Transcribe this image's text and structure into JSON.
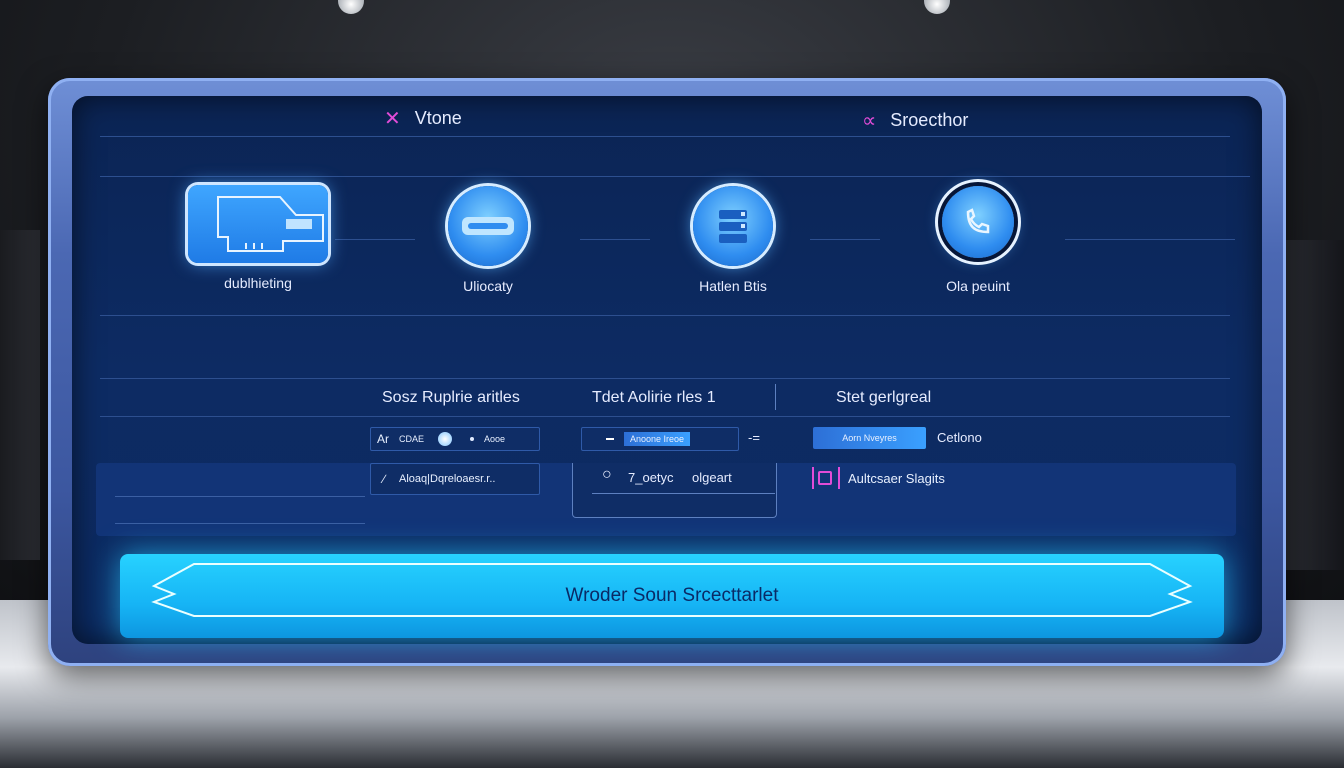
{
  "header": {
    "left": {
      "icon": "pen-icon",
      "label": "Vtone"
    },
    "right": {
      "icon": "link-icon",
      "label": "Sroecthor"
    }
  },
  "tiles": [
    {
      "icon": "screen-icon",
      "label": "dublhieting"
    },
    {
      "icon": "drive-icon",
      "label": "Uliocaty"
    },
    {
      "icon": "storage-icon",
      "label": "Hatlen Btis"
    },
    {
      "icon": "phone-icon",
      "label": "Ola peuint"
    }
  ],
  "sections": {
    "col1_title": "Sosz Ruplrie aritles",
    "col2_title": "Tdet Aolirie rles 1",
    "col3_title": "Stet gerlgreal"
  },
  "controls": {
    "r1_c1_prefix": "Ar",
    "r1_c1_mid": "CDAE",
    "r1_c1_suffix": "Aooe",
    "r1_c2_text": "Anoone Ireoe",
    "r1_c2_suffix": "-=",
    "r1_c3_text": "Aorn Nveyres",
    "r1_c3_label": "Cetlono",
    "r2_c1_text": "Aloaq|Dqreloaesr.r..",
    "r2_c2_label1": "7_oetyc",
    "r2_c2_label2": "olgeart",
    "r2_c3_text": "Aultcsaer Slagits"
  },
  "cta": {
    "label": "Wroder Soun Srcecttarlet"
  },
  "colors": {
    "accent": "#22c4ff",
    "screen_bg": "#0c2a61",
    "icon_pink": "#e24cd8"
  }
}
